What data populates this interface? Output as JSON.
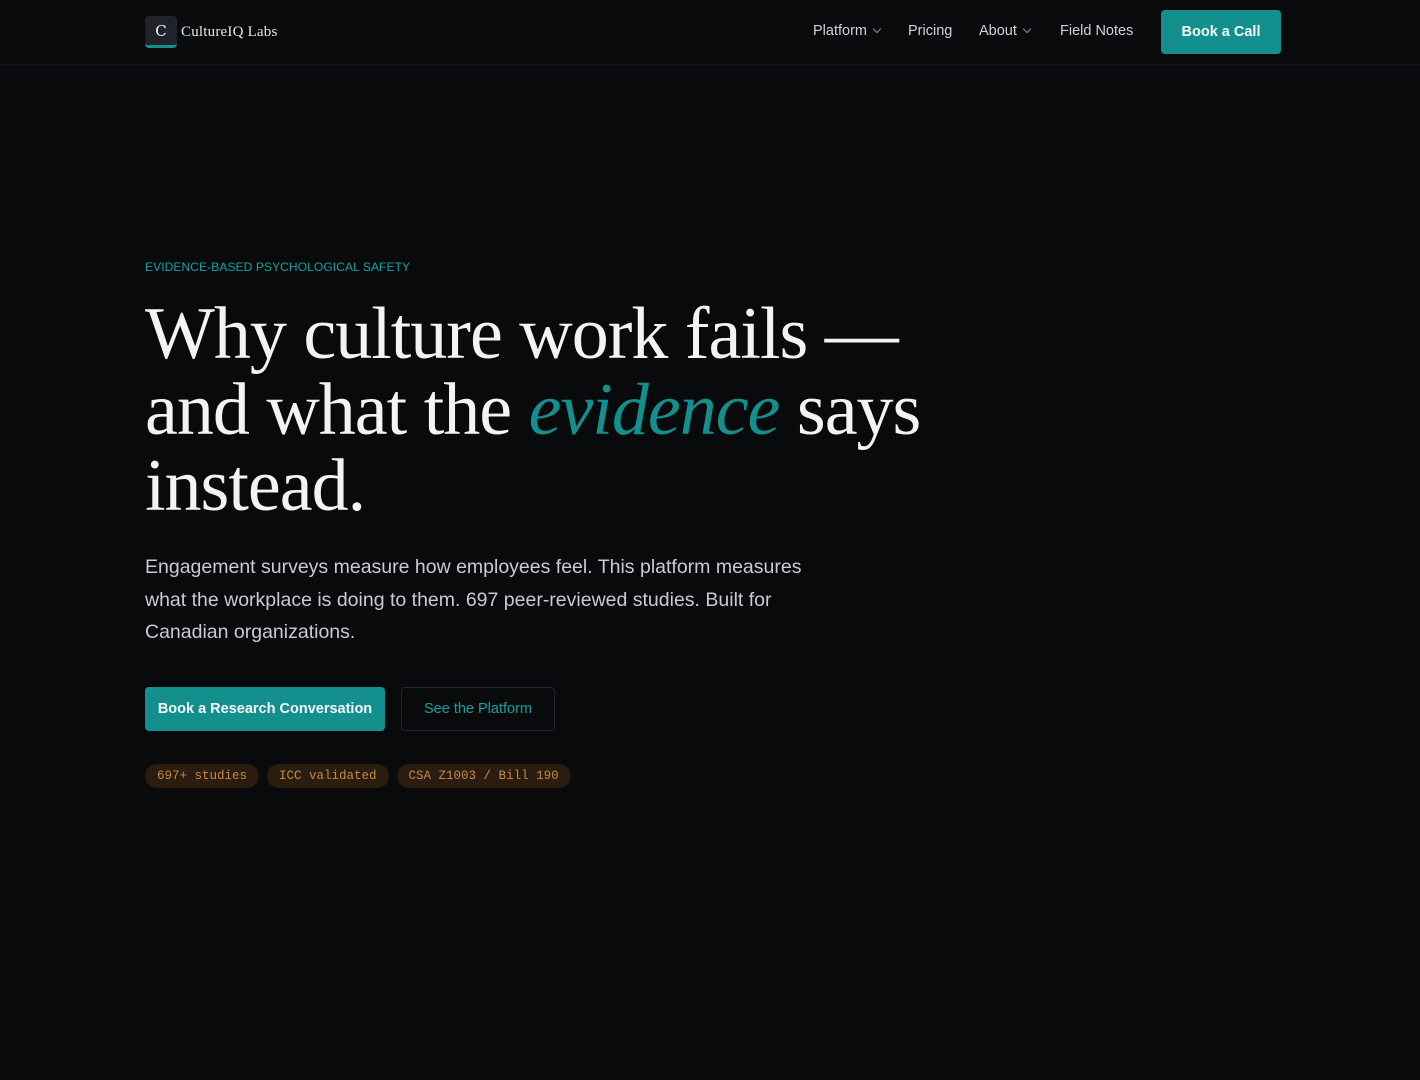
{
  "header": {
    "logo_mark": "C",
    "brand": "CultureIQ Labs",
    "nav": [
      {
        "label": "Platform",
        "has_dropdown": true
      },
      {
        "label": "Pricing",
        "has_dropdown": false
      },
      {
        "label": "About",
        "has_dropdown": true
      },
      {
        "label": "Field Notes",
        "has_dropdown": false
      }
    ],
    "cta_label": "Book a Call"
  },
  "hero": {
    "eyebrow": "EVIDENCE-BASED PSYCHOLOGICAL SAFETY",
    "headline_part1": "Why culture work fails —",
    "headline_part2": "and what the ",
    "headline_accent": "evidence",
    "headline_part3": " says",
    "headline_part4": "instead.",
    "lede": "Engagement surveys measure how employees feel. This platform measures what the workplace is doing to them. 697 peer-reviewed studies. Built for Canadian organizations.",
    "primary_cta": "Book a Research Conversation",
    "secondary_cta": "See the Platform",
    "badges": [
      "697+ studies",
      "ICC validated",
      "CSA Z1003 / Bill 190"
    ]
  },
  "colors": {
    "background": "#080a0c",
    "accent": "#13908d",
    "badge_bg": "#2a1c0e",
    "badge_text": "#c58a3f"
  }
}
